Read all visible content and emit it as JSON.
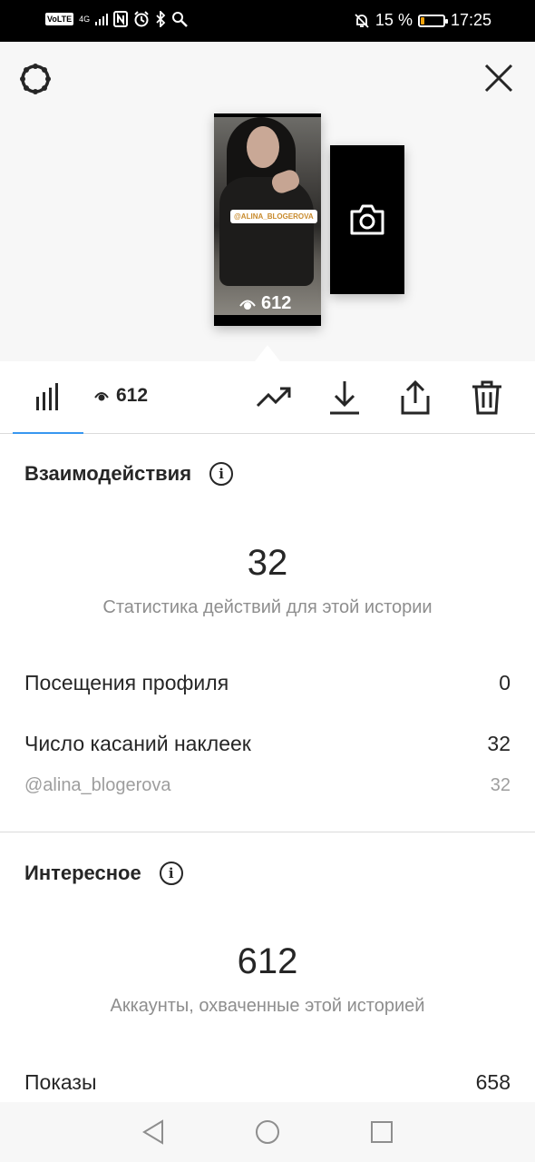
{
  "status_bar": {
    "network_badge": "VoLTE",
    "network_type": "4G",
    "battery_percent": "15 %",
    "time": "17:25"
  },
  "story": {
    "sticker_text": "@ALINA_BLOGEROVA",
    "views": "612"
  },
  "toolbar": {
    "views": "612"
  },
  "interactions": {
    "title": "Взаимодействия",
    "total": "32",
    "caption": "Статистика действий для этой истории",
    "rows": [
      {
        "label": "Посещения профиля",
        "value": "0"
      },
      {
        "label": "Число касаний наклеек",
        "value": "32"
      }
    ],
    "sub_rows": [
      {
        "label": "@alina_blogerova",
        "value": "32"
      }
    ]
  },
  "discovery": {
    "title": "Интересное",
    "total": "612",
    "caption": "Аккаунты, охваченные этой историей",
    "rows": [
      {
        "label": "Показы",
        "value": "658"
      }
    ]
  },
  "colors": {
    "accent": "#3897f0",
    "battery_low": "#f0a30a"
  },
  "icons": [
    "settings-icon",
    "close-icon",
    "camera-icon",
    "eye-icon",
    "bar-chart-icon",
    "trend-icon",
    "download-icon",
    "share-icon",
    "trash-icon",
    "info-icon",
    "back-icon",
    "home-icon",
    "recents-icon"
  ]
}
